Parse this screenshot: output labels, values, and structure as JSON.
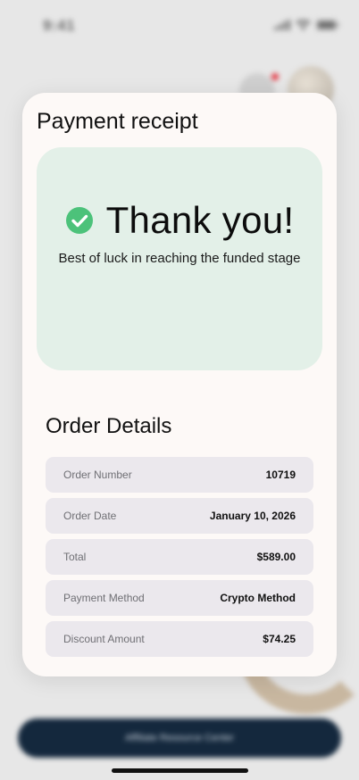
{
  "status_bar": {
    "time": "9:41"
  },
  "modal": {
    "title": "Payment receipt",
    "thanks": {
      "heading": "Thank you!",
      "message": "Best of luck in reaching the funded stage"
    },
    "order_details": {
      "title": "Order Details",
      "rows": [
        {
          "label": "Order Number",
          "value": "10719"
        },
        {
          "label": "Order Date",
          "value": "January 10, 2026"
        },
        {
          "label": "Total",
          "value": "$589.00"
        },
        {
          "label": "Payment Method",
          "value": "Crypto Method"
        },
        {
          "label": "Discount Amount",
          "value": "$74.25"
        }
      ]
    }
  },
  "background": {
    "bottom_button_label": "Affiliate Resource Center"
  },
  "colors": {
    "success_green": "#4cc27a",
    "thanks_card_bg": "#e3f0e8",
    "row_bg": "#ebe8ed",
    "primary_navy": "#14283d"
  },
  "icons": {
    "success": "check-circle-icon",
    "signal": "signal-icon",
    "wifi": "wifi-icon",
    "battery": "battery-icon",
    "notification": "bell-icon"
  }
}
